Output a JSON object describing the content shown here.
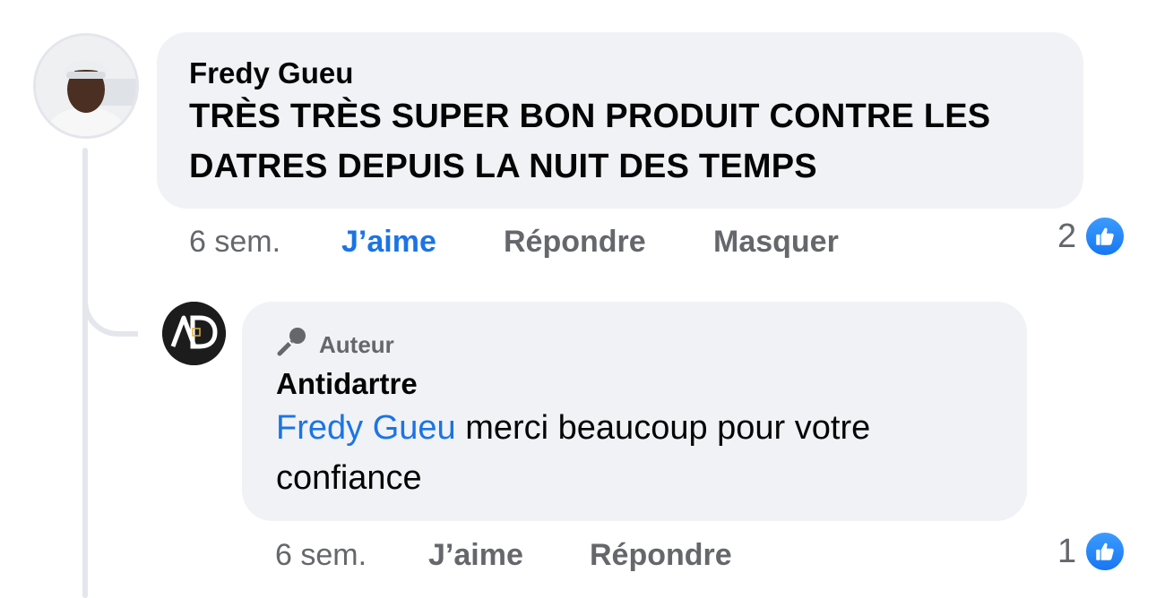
{
  "comment": {
    "author": "Fredy Gueu",
    "text_line1": "TRÈS TRÈS SUPER BON PRODUIT CONTRE LES",
    "text_line2": "DATRES DEPUIS LA NUIT DES TEMPS",
    "time": "6 sem.",
    "like_label": "J’aime",
    "reply_label": "Répondre",
    "hide_label": "Masquer",
    "reaction_count": "2",
    "reaction_icon": "thumbs-up-icon"
  },
  "reply": {
    "badge_icon": "microphone-icon",
    "badge_label": "Auteur",
    "author": "Antidartre",
    "avatar_initials": "AD",
    "mention": "Fredy Gueu",
    "text_after_mention": " merci beaucoup pour votre",
    "text_line2": "confiance",
    "time": "6 sem.",
    "like_label": "J’aime",
    "reply_label": "Répondre",
    "reaction_count": "1",
    "reaction_icon": "thumbs-up-icon"
  },
  "colors": {
    "bubble_bg": "#f0f2f5",
    "accent_blue": "#1b74e4",
    "muted_text": "#65676b",
    "thread_line": "#e4e6eb"
  }
}
